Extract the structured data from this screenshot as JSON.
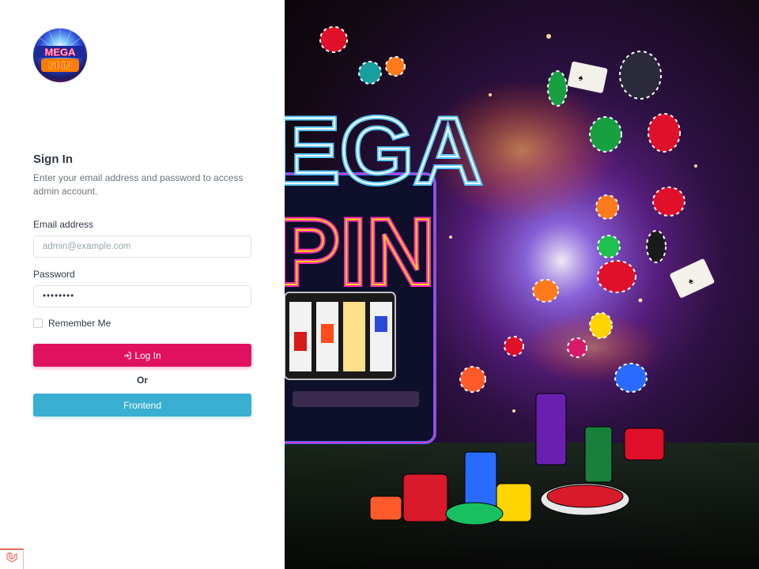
{
  "brand": {
    "logo_text": "MEGA SPIN"
  },
  "signin": {
    "title": "Sign In",
    "subtitle": "Enter your email address and password to access admin account."
  },
  "form": {
    "email_label": "Email address",
    "email_placeholder": "admin@example.com",
    "email_value": "",
    "password_label": "Password",
    "password_value": "••••••••",
    "remember_label": "Remember Me",
    "remember_checked": false,
    "login_label": "Log In",
    "login_icon": "login-icon",
    "or_text": "Or",
    "frontend_label": "Frontend"
  },
  "hero": {
    "sign_text_top": "EGA",
    "sign_text_bottom": "PIN"
  },
  "colors": {
    "login_button": "#e0115f",
    "frontend_button": "#39afd1",
    "heading": "#313a46"
  },
  "corner": {
    "icon": "laravel-icon"
  }
}
